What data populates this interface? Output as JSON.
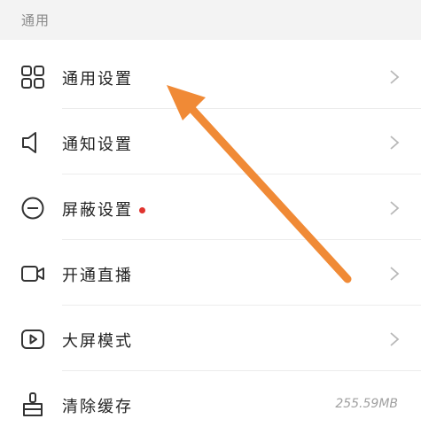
{
  "section": {
    "title": "通用"
  },
  "items": [
    {
      "label": "通用设置",
      "icon": "grid-icon"
    },
    {
      "label": "通知设置",
      "icon": "speaker-icon"
    },
    {
      "label": "屏蔽设置",
      "icon": "minus-circle-icon",
      "badge_color": "#e0332e"
    },
    {
      "label": "开通直播",
      "icon": "video-camera-icon"
    },
    {
      "label": "大屏模式",
      "icon": "play-screen-icon"
    },
    {
      "label": "清除缓存",
      "icon": "brush-icon",
      "value": "255.59MB"
    }
  ],
  "annotation": {
    "arrow_color": "#f08a36"
  }
}
